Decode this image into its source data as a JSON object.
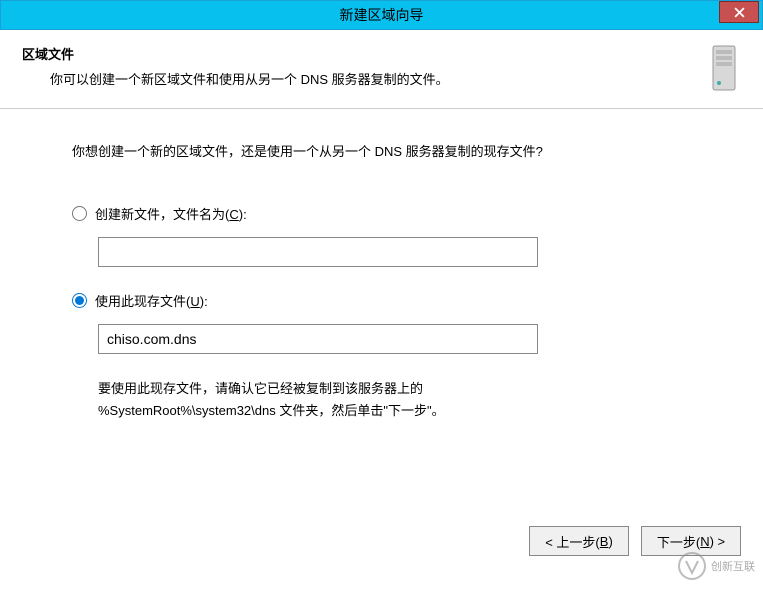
{
  "titlebar": {
    "title": "新建区域向导"
  },
  "header": {
    "title": "区域文件",
    "subtitle": "你可以创建一个新区域文件和使用从另一个 DNS 服务器复制的文件。"
  },
  "content": {
    "question": "你想创建一个新的区域文件，还是使用一个从另一个 DNS 服务器复制的现存文件?",
    "option_new": {
      "label_pre": "创建新文件，文件名为(",
      "accel": "C",
      "label_post": "):",
      "value": ""
    },
    "option_existing": {
      "label_pre": "使用此现存文件(",
      "accel": "U",
      "label_post": "):",
      "value": "chiso.com.dns"
    },
    "note_line1": "要使用此现存文件，请确认它已经被复制到该服务器上的",
    "note_line2": "%SystemRoot%\\system32\\dns 文件夹，然后单击\"下一步\"。"
  },
  "buttons": {
    "back": {
      "pre": "< 上一步(",
      "accel": "B",
      "post": ")"
    },
    "next": {
      "pre": "下一步(",
      "accel": "N",
      "post": ") >"
    }
  },
  "watermark": {
    "text": "创新互联"
  }
}
